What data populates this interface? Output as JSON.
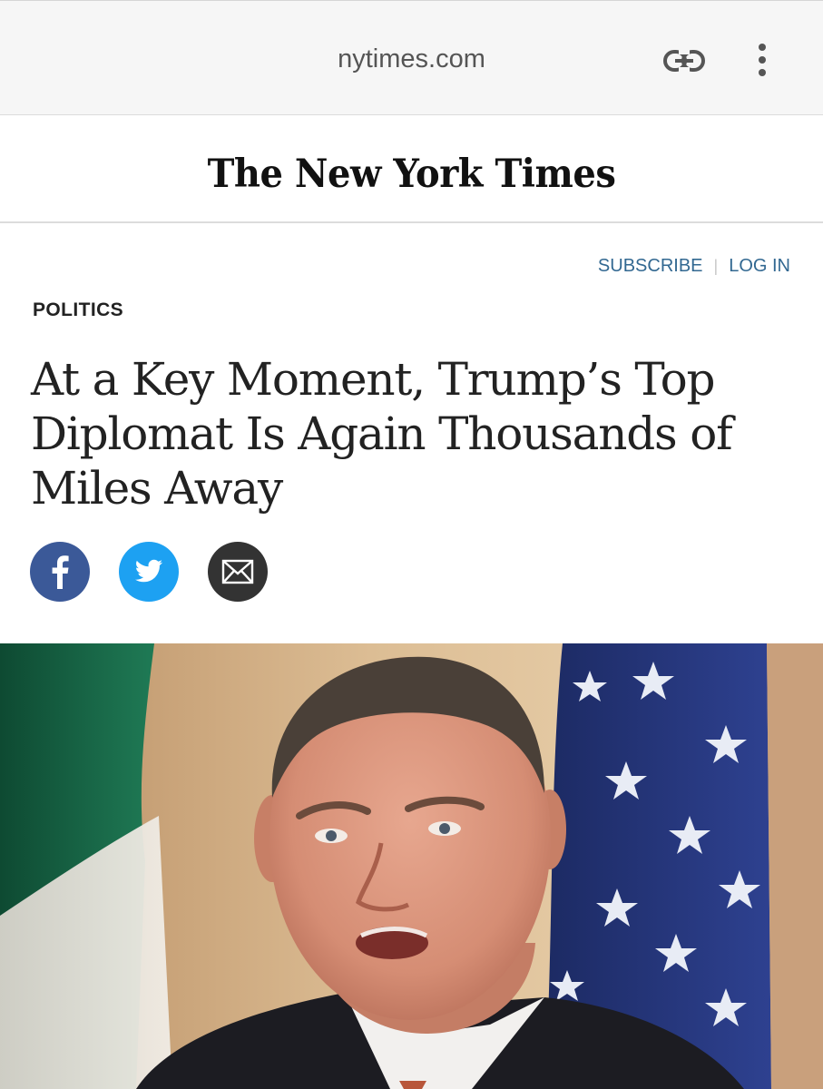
{
  "browser": {
    "url": "nytimes.com",
    "icons": {
      "link": "link-icon",
      "more": "more-vertical-icon"
    }
  },
  "masthead": {
    "logo_text": "The New York Times"
  },
  "account": {
    "subscribe": "SUBSCRIBE",
    "login": "LOG IN"
  },
  "article": {
    "section": "POLITICS",
    "headline": "At a Key Moment, Trump’s Top Diplomat Is Again Thousands of Miles Away"
  },
  "share": {
    "icons": [
      "facebook-icon",
      "twitter-icon",
      "email-icon"
    ],
    "colors": {
      "facebook": "#3b5998",
      "twitter": "#1da1f2",
      "email": "#333333"
    }
  },
  "colors": {
    "link": "#326891",
    "text": "#222222",
    "browser_bar": "#f6f6f6"
  }
}
